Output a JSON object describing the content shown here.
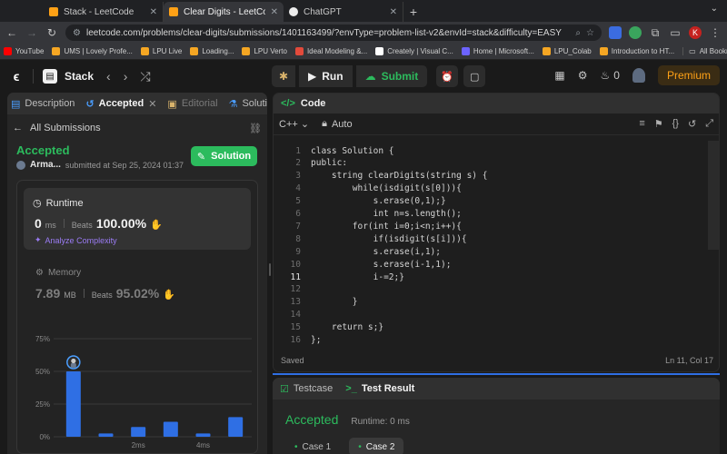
{
  "browser": {
    "tabs": [
      {
        "title": "Stack - LeetCode",
        "active": false
      },
      {
        "title": "Clear Digits - LeetCode",
        "active": true
      },
      {
        "title": "ChatGPT",
        "active": false
      }
    ],
    "url": "leetcode.com/problems/clear-digits/submissions/1401163499/?envType=problem-list-v2&envId=stack&difficulty=EASY",
    "profile_initial": "K",
    "bookmarks": [
      {
        "label": "YouTube",
        "color": "#ff0000"
      },
      {
        "label": "UMS | Lovely Profe...",
        "color": "#f5a623"
      },
      {
        "label": "LPU Live",
        "color": "#f5a623"
      },
      {
        "label": "Loading...",
        "color": "#f5a623"
      },
      {
        "label": "LPU Verto",
        "color": "#f5a623"
      },
      {
        "label": "Ideal Modeling &...",
        "color": "#e24a3b"
      },
      {
        "label": "Creately | Visual C...",
        "color": "#ffffff"
      },
      {
        "label": "Home | Microsoft...",
        "color": "#6c63ff"
      },
      {
        "label": "LPU_Colab",
        "color": "#f5a623"
      },
      {
        "label": "Introduction to HT...",
        "color": "#f5a623"
      }
    ],
    "all_bookmarks": "All Bookmarks"
  },
  "topbar": {
    "problem_list": "Stack",
    "run_label": "Run",
    "submit_label": "Submit",
    "streak": "0",
    "premium_label": "Premium"
  },
  "left": {
    "tabs": {
      "description": "Description",
      "accepted": "Accepted",
      "editorial": "Editorial",
      "solutions": "Solutio"
    },
    "all_submissions": "All Submissions",
    "verdict": "Accepted",
    "author": "Arma...",
    "submitted": "submitted at Sep 25, 2024 01:37",
    "solution_btn": "Solution",
    "runtime": {
      "label": "Runtime",
      "value": "0",
      "unit": "ms",
      "beats_label": "Beats",
      "beats": "100.00%",
      "analyze": "Analyze Complexity"
    },
    "memory": {
      "label": "Memory",
      "value": "7.89",
      "unit": "MB",
      "beats_label": "Beats",
      "beats": "95.02%"
    }
  },
  "chart_data": {
    "type": "bar",
    "y_ticks": [
      "75%",
      "50%",
      "25%",
      "0%"
    ],
    "ylim": [
      0,
      75
    ],
    "x_ticks": [
      {
        "label": "2ms",
        "at": 3
      },
      {
        "label": "4ms",
        "at": 5
      }
    ],
    "values": [
      50,
      2.5,
      7.5,
      11.5,
      2.5,
      15
    ],
    "highlight_index": 0,
    "colors": {
      "bar": "#2f6fe4",
      "grid": "#3a3a3a",
      "label": "#8a8a8a"
    }
  },
  "code": {
    "title": "Code",
    "language": "C++",
    "mode": "Auto",
    "current_line": 11,
    "lines": [
      "class Solution {",
      "public:",
      "    string clearDigits(string s) {",
      "        while(isdigit(s[0])){",
      "            s.erase(0,1);}",
      "            int n=s.length();",
      "        for(int i=0;i<n;i++){",
      "            if(isdigit(s[i])){",
      "            s.erase(i,1);",
      "            s.erase(i-1,1);",
      "            i-=2;}",
      "",
      "        }",
      "",
      "    return s;}",
      "};"
    ],
    "status": "Saved",
    "cursor": "Ln 11, Col 17"
  },
  "test": {
    "testcase_tab": "Testcase",
    "result_tab": "Test Result",
    "verdict": "Accepted",
    "runtime": "Runtime: 0 ms",
    "cases": [
      "Case 1",
      "Case 2"
    ]
  }
}
